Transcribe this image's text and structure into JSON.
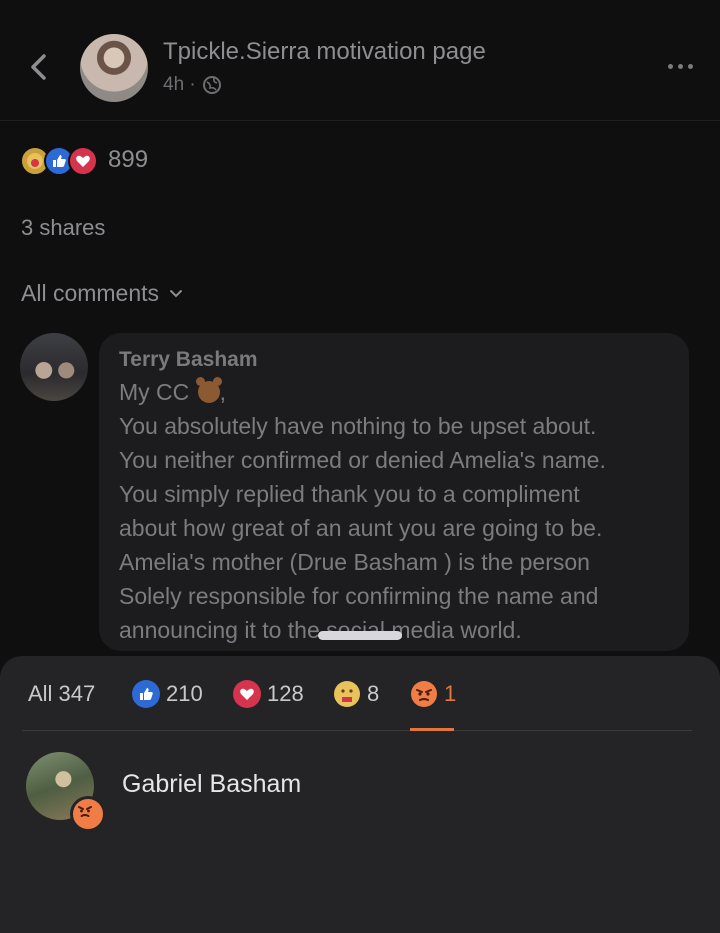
{
  "header": {
    "page_name": "Tpickle.Sierra motivation page",
    "time": "4h ·"
  },
  "reactions": {
    "total": "899",
    "shares": "3 shares",
    "comments_filter": "All comments"
  },
  "comment": {
    "author": "Terry Basham",
    "lines": [
      "My CC",
      "You absolutely have nothing to be upset about.",
      "You neither confirmed or denied Amelia's name.",
      "You simply replied thank you to a compliment",
      "about how great of an aunt you are going to be.",
      "Amelia's mother (Drue Basham ) is the person",
      "Solely responsible for confirming the name and",
      "announcing it to the  social media world."
    ],
    "line0_suffix": ","
  },
  "sheet": {
    "tabs": {
      "all": "All 347",
      "like": "210",
      "love": "128",
      "care": "8",
      "angry": "1"
    },
    "reactor": {
      "name": "Gabriel Basham"
    }
  },
  "colors": {
    "accent": "#e2773a",
    "like": "#2d6ad6",
    "love": "#d6334d",
    "sheet_bg": "#242426"
  },
  "icons": [
    "back-icon",
    "globe-icon",
    "more-icon",
    "chevron-down-icon",
    "like-icon",
    "love-icon",
    "care-icon",
    "angry-icon",
    "bear-icon"
  ]
}
